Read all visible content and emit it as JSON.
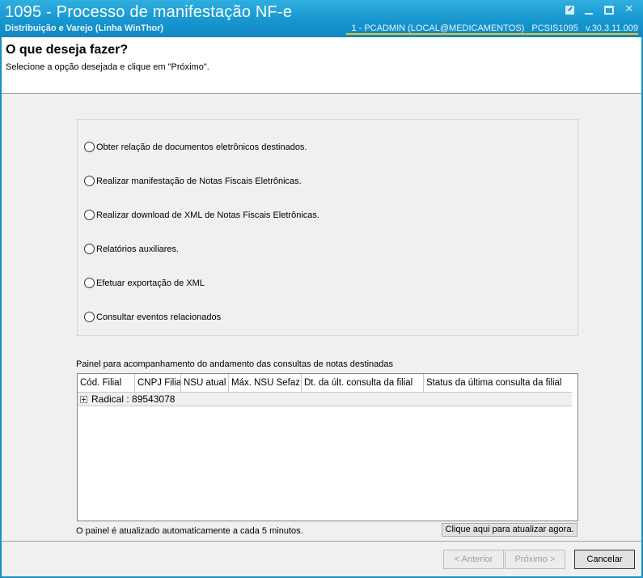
{
  "window": {
    "title": "1095 - Processo de manifestação NF-e",
    "subtitle": "Distribuição e Varejo (Linha WinThor)",
    "connection": "1 - PCADMIN (LOCAL@MEDICAMENTOS)",
    "module": "PCSIS1095",
    "version": "v.30.3.11.009"
  },
  "header": {
    "title": "O que deseja fazer?",
    "description": "Selecione a opção desejada e clique em \"Próximo\"."
  },
  "options": [
    {
      "label": "Obter relação de documentos eletrônicos destinados.",
      "selected": false
    },
    {
      "label": "Realizar manifestação de Notas Fiscais Eletrônicas.",
      "selected": false
    },
    {
      "label": "Realizar download de XML de Notas Fiscais Eletrônicas.",
      "selected": false
    },
    {
      "label": "Relatórios auxiliares.",
      "selected": false
    },
    {
      "label": "Efetuar exportação de XML",
      "selected": false
    },
    {
      "label": "Consultar eventos relacionados",
      "selected": false
    }
  ],
  "panel": {
    "label": "Painel para acompanhamento do andamento das consultas de notas destinadas",
    "columns": [
      "Cód. Filial",
      "CNPJ Filial",
      "NSU atual",
      "Máx. NSU Sefaz",
      "Dt. da últ. consulta da filial",
      "Status da última consulta da filial"
    ],
    "group_row": "Radical : 89543078",
    "refresh_note": "O painel é atualizado automaticamente a cada 5 minutos.",
    "refresh_button": "Clique aqui para atualizar agora."
  },
  "footer": {
    "back_label": "< Anterior",
    "next_label": "Próximo >",
    "cancel_label": "Cancelar"
  }
}
